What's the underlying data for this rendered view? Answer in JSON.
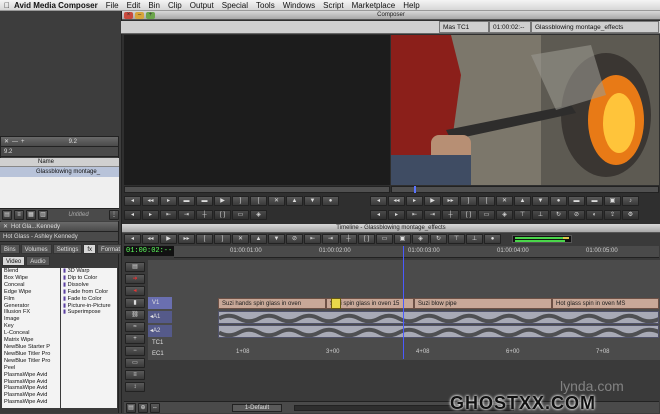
{
  "menubar": {
    "apple": "",
    "app": "Avid Media Composer",
    "items": [
      "File",
      "Edit",
      "Bin",
      "Clip",
      "Output",
      "Special",
      "Tools",
      "Windows",
      "Script",
      "Marketplace",
      "Help"
    ]
  },
  "composer": {
    "title": "Composer",
    "tc_label": "Mas TC1",
    "tc_value": "01:00:02:--",
    "sequence": "Glassblowing montage_effects"
  },
  "bin": {
    "tab": "9.2",
    "title": "9.2",
    "column_name": "Name",
    "item": "Glassblowing montage_",
    "footer": "Untitled"
  },
  "effects": {
    "tabbar": "Hot Gla...Kennedy",
    "tabbar2": "Hot Glass - Ashley Kennedy",
    "tabs": [
      "Bins",
      "Volumes",
      "Settings",
      "Format"
    ],
    "subtabs": [
      "Video",
      "Audio"
    ],
    "categories": [
      "Blend",
      "Box Wipe",
      "Conceal",
      "Edge Wipe",
      "Film",
      "Generator",
      "Illusion FX",
      "Image",
      "Key",
      "L-Conceal",
      "Matrix Wipe",
      "NewBlue Starter P",
      "NewBlue Titler Pro",
      "NewBlue Titler Pro",
      "Peel",
      "PlasmaWipe Avid",
      "PlasmaWipe Avid",
      "PlasmaWipe Avid",
      "PlasmaWipe Avid",
      "PlasmaWipe Avid"
    ],
    "effects_list": [
      "3D Warp",
      "Dip to Color",
      "Dissolve",
      "Fade from Color",
      "Fade to Color",
      "Picture-in-Picture",
      "Superimpose"
    ]
  },
  "timeline": {
    "title": "Timeline - Glassblowing montage_effects",
    "timecode": "01:00:02:--",
    "ruler": [
      "01:00:01:00",
      "01:00:02:00",
      "01:00:03:00",
      "01:00:04:00",
      "01:00:05:00"
    ],
    "tracks": {
      "v1": "V1",
      "a1": "A1",
      "a2": "A2",
      "tc1": "TC1",
      "ec1": "EC1"
    },
    "clips": [
      "Suzi hands spin glass in oven",
      "Suzi spin glass in oven 15",
      "Suzi blow pipe",
      "Hot glass spin in oven MS"
    ],
    "ec_marks": [
      "1+08",
      "3+00",
      "4+08",
      "6+00",
      "7+08"
    ],
    "footer": "1-Default"
  },
  "watermark": {
    "lynda": "lynda.com",
    "ghost": "GHOSTXX.COM"
  }
}
